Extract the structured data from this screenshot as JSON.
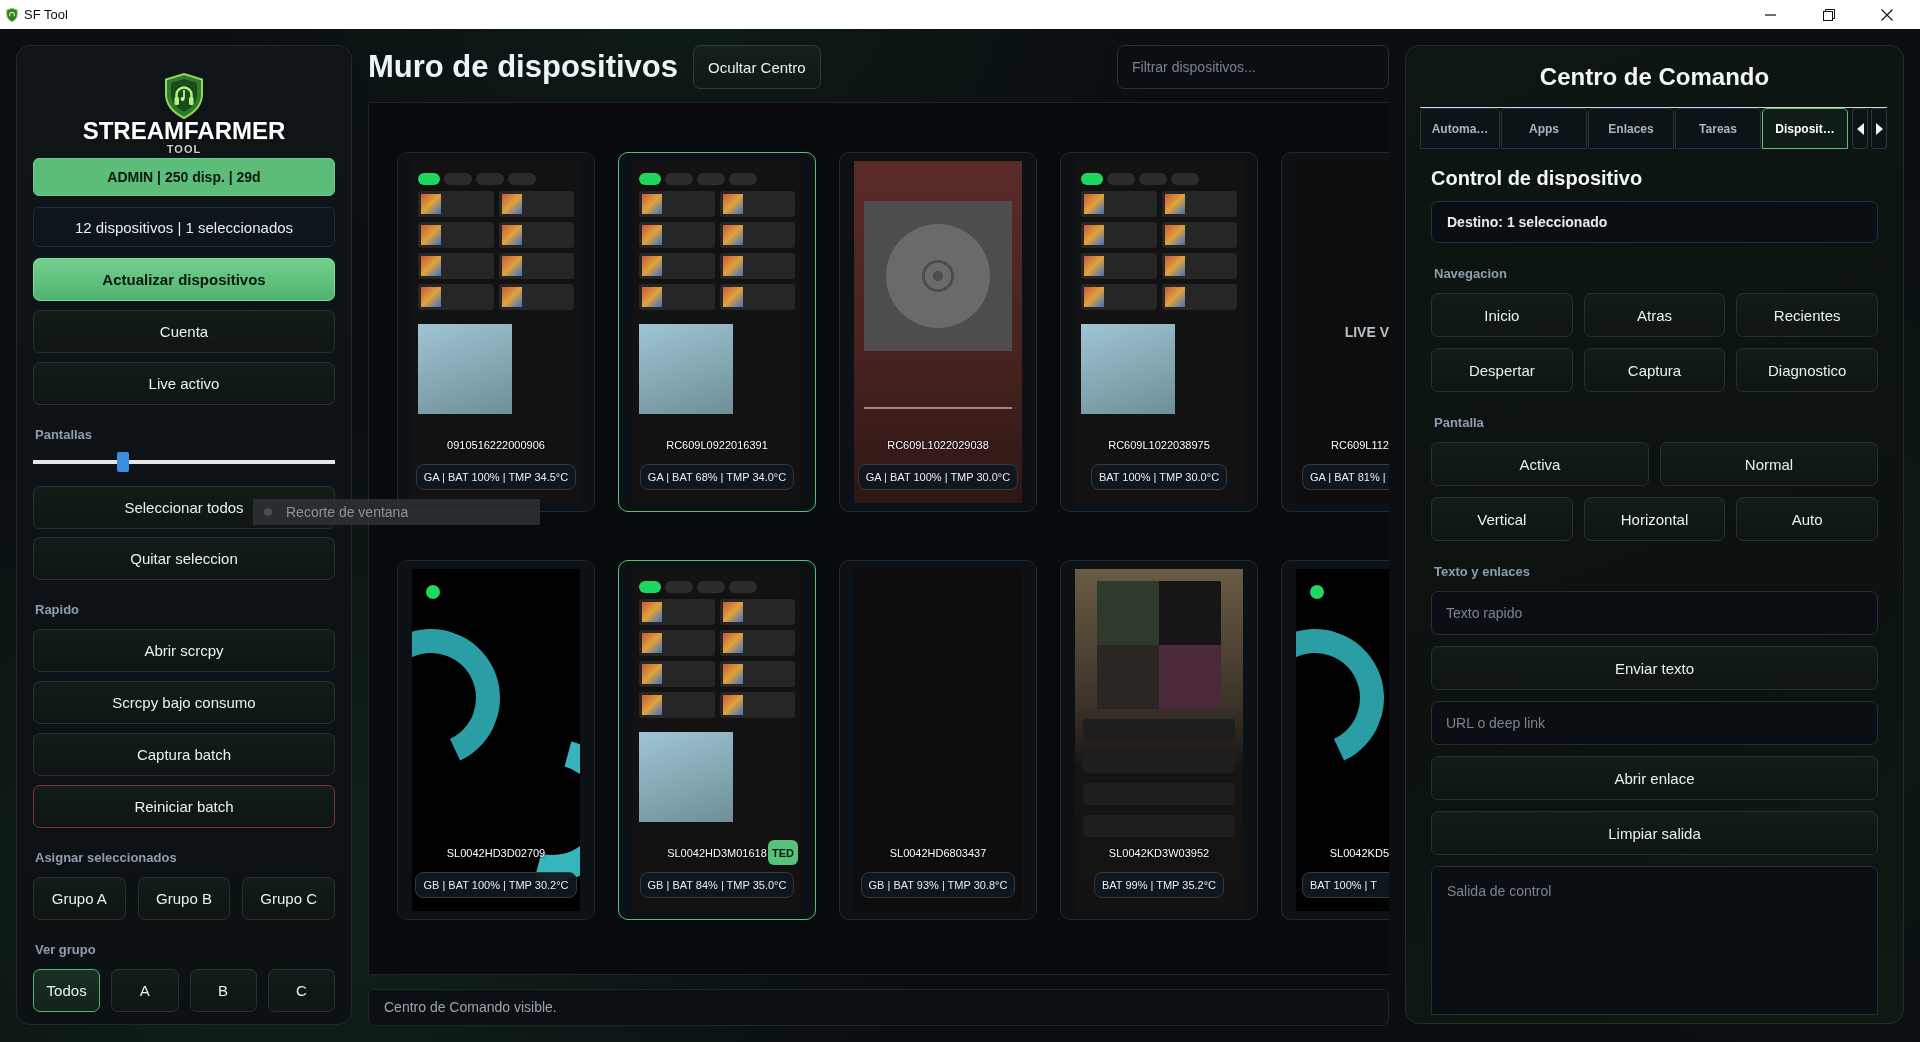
{
  "window": {
    "title": "SF Tool"
  },
  "sidebar": {
    "logo": {
      "title": "STREAMFARMER",
      "subtitle": "TOOL"
    },
    "license": "ADMIN | 250 disp. | 29d",
    "summary": "12 dispositivos | 1 seleccionados",
    "actions": [
      {
        "label": "Actualizar dispositivos",
        "kind": "primary"
      },
      {
        "label": "Cuenta",
        "kind": "normal"
      },
      {
        "label": "Live activo",
        "kind": "normal"
      }
    ],
    "screens": {
      "label": "Pantallas",
      "level": 0.29
    },
    "selection_actions": [
      "Seleccionar todos",
      "Quitar seleccion"
    ],
    "quick": {
      "label": "Rapido",
      "actions": [
        {
          "label": "Abrir scrcpy",
          "kind": "normal"
        },
        {
          "label": "Scrcpy bajo consumo",
          "kind": "normal"
        },
        {
          "label": "Captura batch",
          "kind": "normal"
        },
        {
          "label": "Reiniciar batch",
          "kind": "danger"
        }
      ]
    },
    "assign": {
      "label": "Asignar seleccionados",
      "groups": [
        "Grupo A",
        "Grupo B",
        "Grupo C"
      ]
    },
    "view_group": {
      "label": "Ver grupo",
      "options": [
        {
          "label": "Todos",
          "selected": true
        },
        {
          "label": "A",
          "selected": false
        },
        {
          "label": "B",
          "selected": false
        },
        {
          "label": "C",
          "selected": false
        }
      ]
    }
  },
  "tooltip": {
    "text": "Recorte de ventana"
  },
  "main": {
    "title": "Muro de dispositivos",
    "toggle_button": "Ocultar Centro",
    "filter": {
      "placeholder": "Filtrar dispositivos..."
    },
    "devices": [
      {
        "serial": "0910516222000906",
        "status": "GA | BAT 100% | TMP 34.5°C",
        "kind": "library",
        "selected": false
      },
      {
        "serial": "RC609L0922016391",
        "status": "GA | BAT 68% | TMP 34.0°C",
        "kind": "library",
        "selected": true
      },
      {
        "serial": "RC609L1022029038",
        "status": "GA | BAT 100% | TMP 30.0°C",
        "kind": "player",
        "selected": false
      },
      {
        "serial": "RC609L1022038975",
        "status": "BAT 100% | TMP 30.0°C",
        "kind": "library",
        "selected": false
      },
      {
        "serial": "RC609L112",
        "status": "GA | BAT 81% |",
        "kind": "blank",
        "selected": false,
        "screen_text": "LIVE V"
      },
      {
        "serial": "SL0042HD3D02709",
        "status": "GB | BAT 100% | TMP 30.2°C",
        "kind": "splash",
        "selected": false
      },
      {
        "serial": "SL0042HD3M01618",
        "status": "GB | BAT 84% | TMP 35.0°C",
        "kind": "library",
        "selected": true,
        "badge": "TED"
      },
      {
        "serial": "SL0042HD6803437",
        "status": "GB | BAT 93% | TMP 30.8°C",
        "kind": "blank",
        "selected": false
      },
      {
        "serial": "SL0042KD3W03952",
        "status": "BAT 99% | TMP 35.2°C",
        "kind": "album",
        "selected": false
      },
      {
        "serial": "SL0042KD5",
        "status": "BAT 100% | T",
        "kind": "splash",
        "selected": false
      }
    ],
    "status_bar": "Centro de Comando visible."
  },
  "command_center": {
    "title": "Centro de Comando",
    "tabs": [
      {
        "label": "Automa…",
        "selected": false
      },
      {
        "label": "Apps",
        "selected": false
      },
      {
        "label": "Enlaces",
        "selected": false
      },
      {
        "label": "Tareas",
        "selected": false
      },
      {
        "label": "Disposit…",
        "selected": true
      }
    ],
    "heading": "Control de dispositivo",
    "target": "Destino: 1 seleccionado",
    "sections": [
      {
        "label": "Navegacion",
        "rows": [
          [
            "Inicio",
            "Atras",
            "Recientes"
          ],
          [
            "Despertar",
            "Captura",
            "Diagnostico"
          ]
        ]
      },
      {
        "label": "Pantalla",
        "rows": [
          [
            "Activa",
            "Normal"
          ],
          [
            "Vertical",
            "Horizontal",
            "Auto"
          ]
        ]
      }
    ],
    "text_section": {
      "label": "Texto y enlaces",
      "items": [
        {
          "kind": "input",
          "placeholder": "Texto rapido"
        },
        {
          "kind": "button",
          "label": "Enviar texto"
        },
        {
          "kind": "input",
          "placeholder": "URL o deep link"
        },
        {
          "kind": "button",
          "label": "Abrir enlace"
        },
        {
          "kind": "button",
          "label": "Limpiar salida"
        },
        {
          "kind": "output",
          "placeholder": "Salida de control"
        }
      ]
    }
  }
}
